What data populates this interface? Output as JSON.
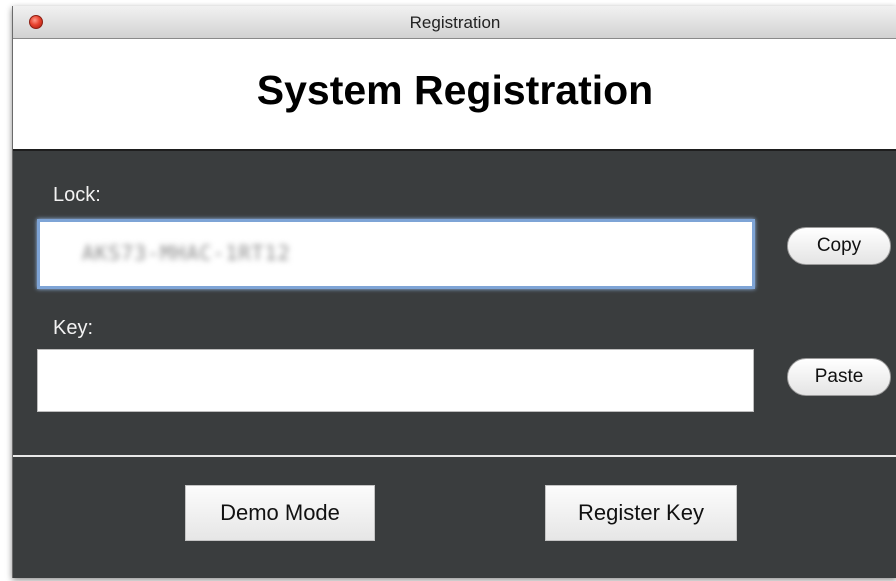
{
  "window": {
    "title": "Registration"
  },
  "header": {
    "title": "System Registration"
  },
  "lock": {
    "label": "Lock:",
    "value": "AKS73-MHAC-1RT12",
    "copy_label": "Copy"
  },
  "key": {
    "label": "Key:",
    "value": "",
    "paste_label": "Paste"
  },
  "actions": {
    "demo_label": "Demo Mode",
    "register_label": "Register Key"
  },
  "colors": {
    "panel": "#3a3d3e",
    "focus_ring": "#7ea4d6",
    "close_button": "#e8432f"
  },
  "icons": {
    "close": "close-icon"
  }
}
